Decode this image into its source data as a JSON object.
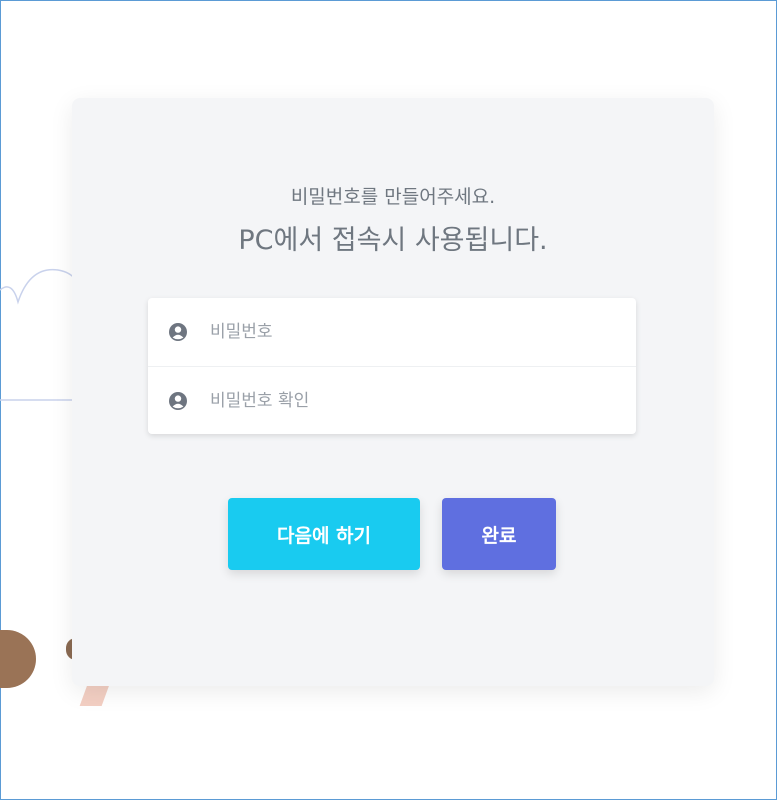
{
  "dialog": {
    "title_line1": "비밀번호를 만들어주세요.",
    "title_line2": "PC에서 접속시 사용됩니다."
  },
  "fields": [
    {
      "placeholder": "비밀번호",
      "icon": "user-icon"
    },
    {
      "placeholder": "비밀번호 확인",
      "icon": "user-icon"
    }
  ],
  "buttons": {
    "later_label": "다음에 하기",
    "done_label": "완료"
  },
  "colors": {
    "later_button": "#19cbf0",
    "done_button": "#5f6fe0",
    "card_background": "#f4f5f7"
  }
}
